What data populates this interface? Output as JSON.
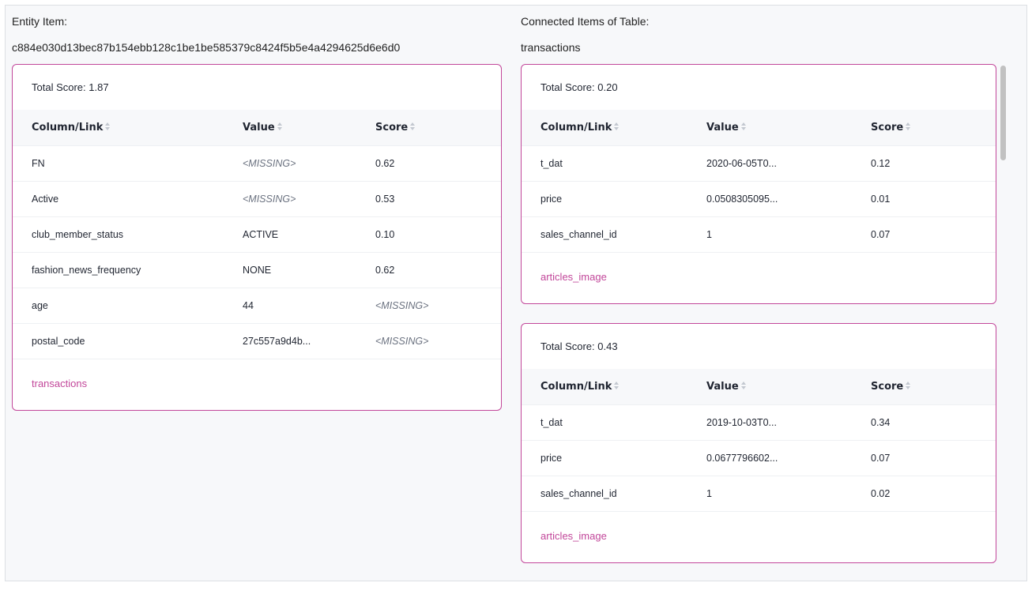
{
  "entity": {
    "label": "Entity Item:",
    "id": "c884e030d13bec87b154ebb128c1be1be585379c8424f5b5e4a4294625d6e6d0",
    "total_score": "Total Score: 1.87",
    "columns": [
      "Column/Link",
      "Value",
      "Score"
    ],
    "rows": [
      {
        "column": "FN",
        "value": "<MISSING>",
        "score": "0.62"
      },
      {
        "column": "Active",
        "value": "<MISSING>",
        "score": "0.53"
      },
      {
        "column": "club_member_status",
        "value": "ACTIVE",
        "score": "0.10"
      },
      {
        "column": "fashion_news_frequency",
        "value": "NONE",
        "score": "0.62"
      },
      {
        "column": "age",
        "value": "44",
        "score": "<MISSING>"
      },
      {
        "column": "postal_code",
        "value": "27c557a9d4b...",
        "score": "<MISSING>"
      }
    ],
    "link": "transactions"
  },
  "connected": {
    "label": "Connected Items of Table:",
    "table": "transactions",
    "cards": [
      {
        "total_score": "Total Score: 0.20",
        "columns": [
          "Column/Link",
          "Value",
          "Score"
        ],
        "rows": [
          {
            "column": "t_dat",
            "value": "2020-06-05T0...",
            "score": "0.12"
          },
          {
            "column": "price",
            "value": "0.0508305095...",
            "score": "0.01"
          },
          {
            "column": "sales_channel_id",
            "value": "1",
            "score": "0.07"
          }
        ],
        "link": "articles_image"
      },
      {
        "total_score": "Total Score: 0.43",
        "columns": [
          "Column/Link",
          "Value",
          "Score"
        ],
        "rows": [
          {
            "column": "t_dat",
            "value": "2019-10-03T0...",
            "score": "0.34"
          },
          {
            "column": "price",
            "value": "0.0677796602...",
            "score": "0.07"
          },
          {
            "column": "sales_channel_id",
            "value": "1",
            "score": "0.02"
          }
        ],
        "link": "articles_image"
      }
    ]
  },
  "missing_token": "<MISSING>",
  "colors": {
    "accent": "#c2479a",
    "border": "#dcdfe4",
    "header_bg": "#f7f8fa"
  },
  "icons": {
    "sort": "sort-icon"
  }
}
